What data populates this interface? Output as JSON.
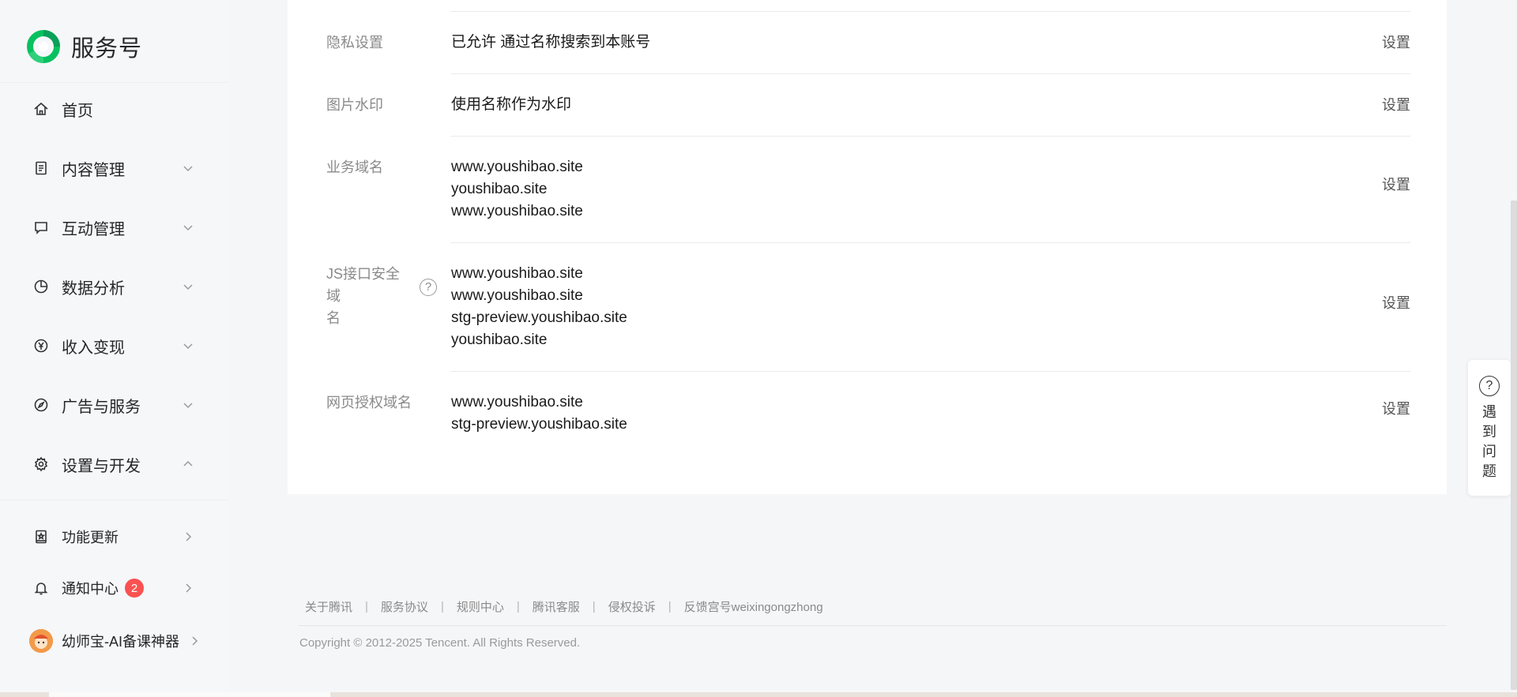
{
  "brand": {
    "name": "服务号",
    "colors": {
      "primary": "#07c160",
      "accent": "#0aa05a"
    }
  },
  "sidebar": {
    "items": [
      {
        "label": "首页",
        "icon": "home-icon",
        "expandable": false
      },
      {
        "label": "内容管理",
        "icon": "document-icon",
        "expandable": true,
        "state": "collapsed"
      },
      {
        "label": "互动管理",
        "icon": "chat-bubble-icon",
        "expandable": true,
        "state": "collapsed"
      },
      {
        "label": "数据分析",
        "icon": "pie-chart-icon",
        "expandable": true,
        "state": "collapsed"
      },
      {
        "label": "收入变现",
        "icon": "yuan-coin-icon",
        "expandable": true,
        "state": "collapsed"
      },
      {
        "label": "广告与服务",
        "icon": "compass-icon",
        "expandable": true,
        "state": "collapsed"
      },
      {
        "label": "设置与开发",
        "icon": "gear-icon",
        "expandable": true,
        "state": "expanded"
      }
    ],
    "bottom_items": [
      {
        "label": "功能更新",
        "icon": "update-book-icon"
      },
      {
        "label": "通知中心",
        "icon": "bell-icon",
        "badge": "2"
      },
      {
        "label": "幼师宝-AI备课神器",
        "icon": "avatar"
      }
    ],
    "badge_color": "#fa5151"
  },
  "settings": {
    "action_label": "设置",
    "rows": [
      {
        "label": "隐私设置",
        "values": [
          "已允许 通过名称搜索到本账号"
        ]
      },
      {
        "label": "图片水印",
        "values": [
          "使用名称作为水印"
        ]
      },
      {
        "label": "业务域名",
        "values": [
          "www.youshibao.site",
          "youshibao.site",
          "www.youshibao.site"
        ]
      },
      {
        "label_line1": "JS接口安全域",
        "label_line2": "名",
        "values": [
          "www.youshibao.site",
          "www.youshibao.site",
          "stg-preview.youshibao.site",
          "youshibao.site"
        ],
        "help_icon": "?"
      },
      {
        "label": "网页授权域名",
        "values": [
          "www.youshibao.site",
          "stg-preview.youshibao.site"
        ]
      }
    ]
  },
  "footer": {
    "links": [
      "关于腾讯",
      "服务协议",
      "规则中心",
      "腾讯客服",
      "侵权投诉",
      "反馈宫号weixingongzhong"
    ],
    "separator": "|",
    "copyright": "Copyright © 2012-2025 Tencent. All Rights Reserved."
  },
  "float_help": {
    "icon": "?",
    "text": "遇到问题"
  }
}
